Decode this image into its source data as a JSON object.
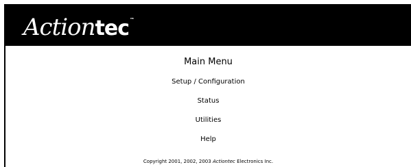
{
  "header": {
    "logo": {
      "script_part": "Action",
      "bold_part": "tec",
      "trademark": "™"
    }
  },
  "main": {
    "title": "Main Menu",
    "menu_items": [
      {
        "label": "Setup / Configuration"
      },
      {
        "label": "Status"
      },
      {
        "label": "Utilities"
      },
      {
        "label": "Help"
      }
    ]
  },
  "footer": {
    "copyright_prefix": "Copyright 2001, 2002, 2003",
    "brand_name": "Actiontec",
    "copyright_suffix": "Electronics Inc."
  },
  "colors": {
    "header_background": "#000000",
    "logo_text": "#ffffff",
    "page_background": "#ffffff",
    "text": "#000000"
  }
}
